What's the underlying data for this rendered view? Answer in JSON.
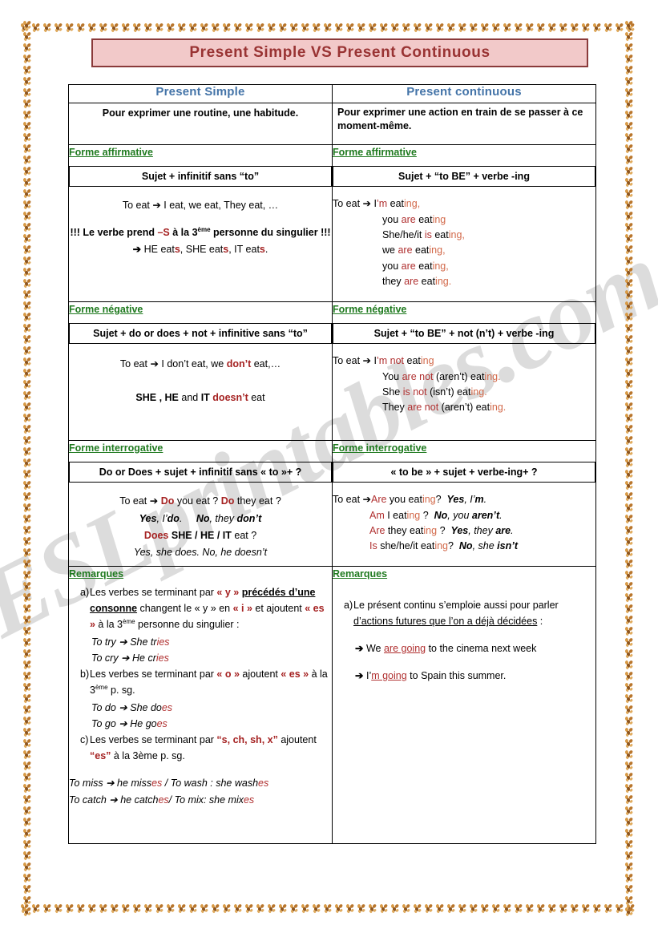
{
  "title": {
    "text": "Present Simple  VS  Present Continuous"
  },
  "watermark": {
    "text": "ESLprintables.com"
  },
  "columns": {
    "left_header": "Present Simple",
    "right_header": "Present continuous"
  },
  "left": {
    "intro": "Pour exprimer une routine, une habitude.",
    "affirmative": {
      "heading": "Forme affirmative",
      "formula": "Sujet + infinitif sans “to”",
      "example": "To eat ➔ I eat, we eat, They eat, …",
      "notice_line1_a": "!!! Le verbe prend ",
      "notice_line1_s": "–S",
      "notice_line1_b": " à la 3",
      "notice_sup": "ème",
      "notice_line1_c": " personne du singulier !!!",
      "notice_line2_arrow": "➔",
      "notice_line2": "HE eats, SHE eats, IT eats."
    },
    "negative": {
      "heading": "Forme négative",
      "formula": "Sujet + do or does + not + infinitive sans “to”",
      "example_a": "To eat ➔ I don’t eat, we ",
      "example_b": "don’t",
      "example_c": " eat,…",
      "example2_a": "SHE , HE",
      "example2_b": " and ",
      "example2_c": "IT ",
      "example2_d": "doesn’t",
      "example2_e": " eat"
    },
    "interrogative": {
      "heading": "Forme interrogative",
      "formula": "Do or Does  + sujet + infinitif sans « to »+ ?",
      "line1_pre": "To eat ➔ ",
      "line1_do1": "Do",
      "line1_mid": " you eat ? ",
      "line1_do2": "Do",
      "line1_end": " they eat ?",
      "line2_yes": "Yes",
      "line2_a": ", I’",
      "line2_do": "do",
      "line2_b": ".",
      "line2_no": "No",
      "line2_c": ", they ",
      "line2_dont": "don’t",
      "line3_does": "Does",
      "line3_rest": "SHE / HE / IT",
      "line3_end": "eat ?",
      "line4": "Yes, she does. No, he doesn’t"
    },
    "remarks": {
      "heading": "Remarques",
      "items": [
        {
          "marker": "a)",
          "t1": "Les  verbes se terminant par ",
          "y1": "« y »",
          "t2": " ",
          "u1": "précédés d’une consonne",
          "t3": " changent le ",
          "t4": "« y » en ",
          "i1": "« i »",
          "t5": " et ajoutent ",
          "es1": "« es »",
          "t6": " à la 3",
          "sup": "ème",
          "t7": " personne du singulier :"
        },
        {
          "marker": "b)",
          "t1": "Les verbes se terminant par ",
          "y1": "« o »",
          "t2": " ajoutent ",
          "es1": "« es »",
          "t3": " à la 3",
          "sup": "ème",
          "t4": " p. sg."
        },
        {
          "marker": "c)",
          "t1": "Les verbes se terminant par ",
          "y1": "“s, ch, sh, x”",
          "t2": " ajoutent ",
          "es1": "“es”",
          "t3": " à la 3ème p. sg."
        }
      ],
      "examples_a": [
        "To try ➔ She tries",
        "To cry ➔ He cries"
      ],
      "examples_b": [
        "To do ➔ She does",
        "To go ➔ He goes"
      ],
      "examples_c": [
        "To miss  ➔ he misses / To wash : she washes",
        "To catch  ➔ he catches/ To mix: she mixes"
      ]
    }
  },
  "right": {
    "intro": "Pour exprimer une action en train de se passer à ce moment-même.",
    "affirmative": {
      "heading": "Forme affirmative",
      "formula": "Sujet + “to BE” + verbe -ing",
      "lead": "To eat ➔ ",
      "lines": [
        {
          "subj": "I",
          "aux": "’m",
          "verb": " eat",
          "ing": "ing",
          "tail": ","
        },
        {
          "subj": "you ",
          "aux": "are",
          "verb": " eat",
          "ing": "ing",
          "tail": ""
        },
        {
          "subj": "She/he/it ",
          "aux": "is",
          "verb": " eat",
          "ing": "ing",
          "tail": ","
        },
        {
          "subj": "we ",
          "aux": "are",
          "verb": " eat",
          "ing": "ing",
          "tail": ","
        },
        {
          "subj": "you ",
          "aux": "are",
          "verb": " eat",
          "ing": "ing",
          "tail": ","
        },
        {
          "subj": "they ",
          "aux": "are",
          "verb": " eat",
          "ing": "ing",
          "tail": "."
        }
      ]
    },
    "negative": {
      "heading": "Forme négative",
      "formula": "Sujet + “to BE” + not (n’t) + verbe -ing",
      "lead": "To eat ➔ ",
      "lines": [
        {
          "subj": "I",
          "aux": "’m not",
          "verb": " eat",
          "ing": "ing",
          "tail": ""
        },
        {
          "subj": "You ",
          "aux": "are not",
          "verb": " (aren’t) eat",
          "ing": "ing",
          "tail": "."
        },
        {
          "subj": "She ",
          "aux": "is not",
          "verb": " (isn’t) eat",
          "ing": "ing",
          "tail": "."
        },
        {
          "subj": "They ",
          "aux": "are not",
          "verb": " (aren’t) eat",
          "ing": "ing",
          "tail": "."
        }
      ]
    },
    "interrogative": {
      "heading": "Forme interrogative",
      "formula": "« to be » + sujet + verbe-ing+ ?",
      "lead": "To eat ➔",
      "lines": [
        {
          "aux": "Are",
          "q": " you eat",
          "ing": "ing",
          "qm": "?",
          "ansbold": "Yes",
          "ansrest": ", I’",
          "ansbold2": "m",
          "ansend": "."
        },
        {
          "aux": "Am",
          "q": " I eat",
          "ing": "ing",
          "qm": " ?",
          "ansbold": "No",
          "ansrest": ", you ",
          "ansbold2": "aren’t",
          "ansend": "."
        },
        {
          "aux": "Are",
          "q": " they eat",
          "ing": "ing",
          "qm": " ?",
          "ansbold": "Yes",
          "ansrest": ", they ",
          "ansbold2": "are",
          "ansend": "."
        },
        {
          "aux": "Is",
          "q": " she/he/it  eat",
          "ing": "ing",
          "qm": "?",
          "ansbold": "No",
          "ansrest": ", she ",
          "ansbold2": "isn’t",
          "ansend": ""
        }
      ]
    },
    "remarks": {
      "heading": "Remarques",
      "item_marker": "a)",
      "item_t1": "Le présent continu s’emploie aussi pour parler ",
      "item_u": "d’actions futures que l’on a déjà décidées",
      "item_t2": " :",
      "bullets": [
        {
          "arrow": "➔",
          "pre": "We ",
          "hl": "are going",
          "post": " to the cinema next week"
        },
        {
          "arrow": "➔",
          "pre": "I’",
          "hl": "m going",
          "post": " to Spain this summer."
        }
      ]
    }
  }
}
